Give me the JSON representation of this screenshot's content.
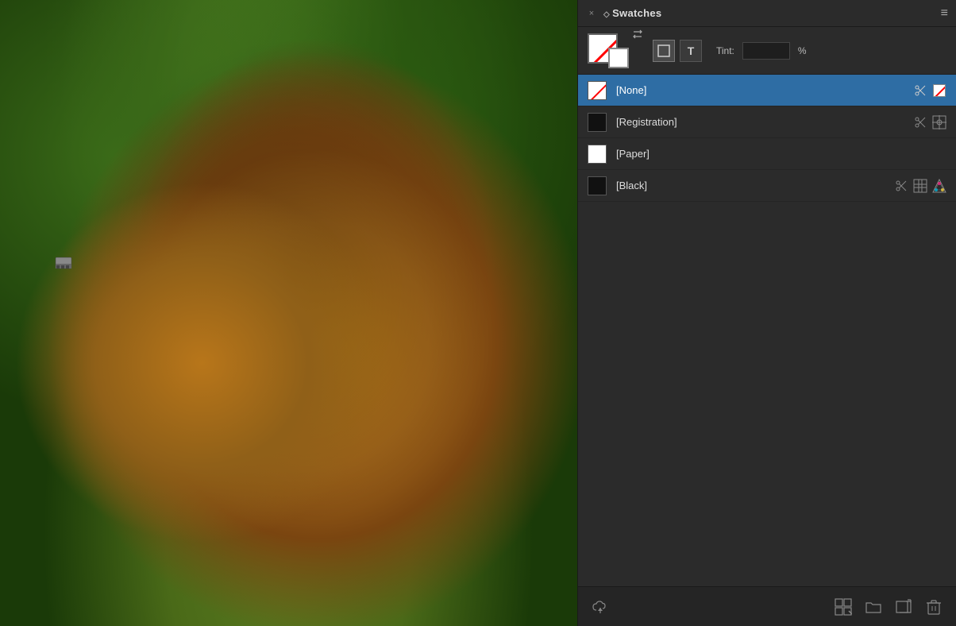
{
  "panel": {
    "title": "Swatches",
    "close_label": "×",
    "menu_label": "≡",
    "tint_label": "Tint:",
    "tint_value": "",
    "tint_unit": "%"
  },
  "color_selector": {
    "mode_fill_label": "□",
    "mode_text_label": "T"
  },
  "swatches": [
    {
      "name": "[None]",
      "color_type": "none",
      "selected": true,
      "icons": [
        "scissors",
        "paper"
      ]
    },
    {
      "name": "[Registration]",
      "color_type": "black",
      "selected": false,
      "icons": [
        "scissors",
        "crosshair"
      ]
    },
    {
      "name": "[Paper]",
      "color_type": "white",
      "selected": false,
      "icons": []
    },
    {
      "name": "[Black]",
      "color_type": "black",
      "selected": false,
      "icons": [
        "scissors",
        "grid",
        "color"
      ]
    }
  ],
  "footer": {
    "cloud_label": "☁",
    "grid_label": "⊞",
    "folder_label": "📁",
    "new_label": "↵",
    "delete_label": "🗑"
  }
}
